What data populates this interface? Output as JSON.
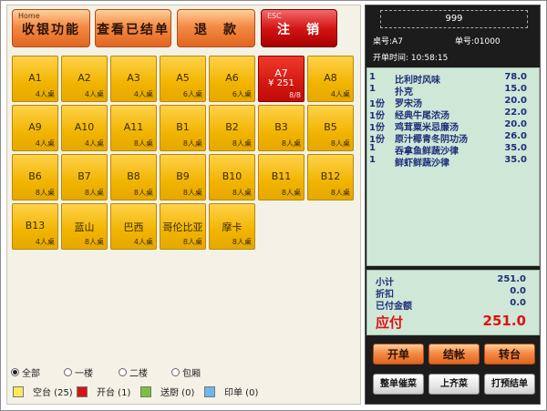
{
  "toolbar": {
    "receive": {
      "hint": "Home",
      "label": "收银功能"
    },
    "view_settled": {
      "label": "查看已结单"
    },
    "refund": {
      "label": "退　款"
    },
    "logout": {
      "hint": "ESC",
      "label": "注　销"
    }
  },
  "tables": [
    {
      "name": "A1",
      "cap": "4人桌",
      "status": "free"
    },
    {
      "name": "A2",
      "cap": "4人桌",
      "status": "free"
    },
    {
      "name": "A3",
      "cap": "4人桌",
      "status": "free"
    },
    {
      "name": "A5",
      "cap": "6人桌",
      "status": "free"
    },
    {
      "name": "A6",
      "cap": "6人桌",
      "status": "free"
    },
    {
      "name": "A7",
      "amount": "¥ 251",
      "cap": "8/8",
      "status": "open"
    },
    {
      "name": "A8",
      "cap": "4人桌",
      "status": "free"
    },
    {
      "name": "A9",
      "cap": "4人桌",
      "status": "free"
    },
    {
      "name": "A10",
      "cap": "4人桌",
      "status": "free"
    },
    {
      "name": "A11",
      "cap": "8人桌",
      "status": "free"
    },
    {
      "name": "B1",
      "cap": "8人桌",
      "status": "free"
    },
    {
      "name": "B2",
      "cap": "8人桌",
      "status": "free"
    },
    {
      "name": "B3",
      "cap": "8人桌",
      "status": "free"
    },
    {
      "name": "B5",
      "cap": "8人桌",
      "status": "free"
    },
    {
      "name": "B6",
      "cap": "8人桌",
      "status": "free"
    },
    {
      "name": "B7",
      "cap": "8人桌",
      "status": "free"
    },
    {
      "name": "B8",
      "cap": "8人桌",
      "status": "free"
    },
    {
      "name": "B9",
      "cap": "8人桌",
      "status": "free"
    },
    {
      "name": "B10",
      "cap": "8人桌",
      "status": "free"
    },
    {
      "name": "B11",
      "cap": "8人桌",
      "status": "free"
    },
    {
      "name": "B12",
      "cap": "8人桌",
      "status": "free"
    },
    {
      "name": "B13",
      "cap": "4人桌",
      "status": "free"
    },
    {
      "name": "蓝山",
      "cap": "8人桌",
      "status": "free"
    },
    {
      "name": "巴西",
      "cap": "4人桌",
      "status": "free"
    },
    {
      "name": "哥伦比亚",
      "cap": "8人桌",
      "status": "free"
    },
    {
      "name": "摩卡",
      "cap": "8人桌",
      "status": "free"
    }
  ],
  "filters": [
    {
      "label": "全部",
      "selected": true
    },
    {
      "label": "一楼",
      "selected": false
    },
    {
      "label": "二楼",
      "selected": false
    },
    {
      "label": "包厢",
      "selected": false
    }
  ],
  "legend": [
    {
      "label": "空台 (25)",
      "color": "#ffe95a"
    },
    {
      "label": "开台 (1)",
      "color": "#d41515"
    },
    {
      "label": "送厨 (0)",
      "color": "#7ac142"
    },
    {
      "label": "印单 (0)",
      "color": "#6fb6f0"
    }
  ],
  "order": {
    "code": "999",
    "table_label": "桌号:A7",
    "bill_label": "单号:01000",
    "time_label": "开单时间: 10:58:15",
    "items": [
      {
        "qty": "1",
        "name": "比利时风味",
        "price": "78.0"
      },
      {
        "qty": "1",
        "name": "扑克",
        "price": "15.0"
      },
      {
        "qty": "1份",
        "name": "罗宋汤",
        "price": "20.0"
      },
      {
        "qty": "1份",
        "name": "经典牛尾浓汤",
        "price": "22.0"
      },
      {
        "qty": "1份",
        "name": "鸡茸粟米忌廉汤",
        "price": "20.0"
      },
      {
        "qty": "1份",
        "name": "原汁椰青冬阴功汤",
        "price": "26.0"
      },
      {
        "qty": "1",
        "name": "吞拿鱼鲜蔬沙律",
        "price": "35.0"
      },
      {
        "qty": "1",
        "name": "鲜虾鲜蔬沙律",
        "price": "35.0"
      }
    ],
    "subtotal_label": "小计",
    "subtotal": "251.0",
    "discount_label": "折扣",
    "discount": "0.0",
    "paid_label": "已付金额",
    "paid": "0.0",
    "due_label": "应付",
    "due": "251.0"
  },
  "actions": {
    "open": "开单",
    "checkout": "结帐",
    "transfer": "转台",
    "rush": "整单催菜",
    "serve_all": "上齐菜",
    "print_bill": "打预结单"
  }
}
